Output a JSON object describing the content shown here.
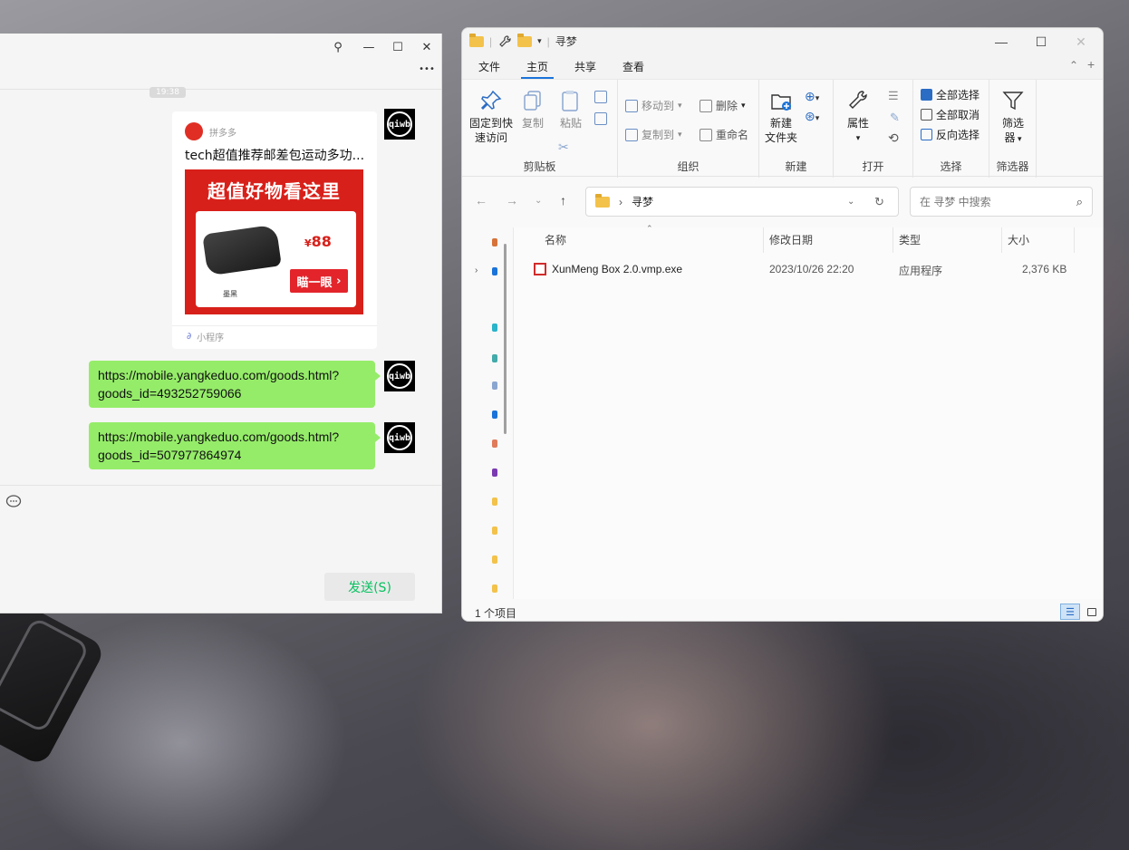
{
  "chat": {
    "time_chip": "19:38",
    "avatar_text": "qiwb",
    "mini_program": {
      "source": "拼多多",
      "title": "tech超值推荐邮差包运动多功...",
      "banner": "超值好物看这里",
      "price_symbol": "¥",
      "price": "88",
      "cta": "瞄一眼",
      "brand": "墨黑",
      "footer": "小程序"
    },
    "messages": [
      {
        "line1": "https://mobile.yangkeduo.com/goods.html?",
        "line2": "goods_id=493252759066"
      },
      {
        "line1": "https://mobile.yangkeduo.com/goods.html?",
        "line2": "goods_id=507977864974"
      }
    ],
    "send_label": "发送(S)",
    "controls": {
      "pin": "⚲",
      "min": "—",
      "max": "☐",
      "close": "✕",
      "more": "•••"
    }
  },
  "explorer": {
    "title": "寻梦",
    "tabs": [
      "文件",
      "主页",
      "共享",
      "查看"
    ],
    "active_tab": "主页",
    "ribbon": {
      "clipboard": {
        "label": "剪贴板",
        "pin_line1": "固定到快",
        "pin_line2": "速访问",
        "copy": "复制",
        "paste": "粘贴"
      },
      "organize": {
        "label": "组织",
        "move_to": "移动到",
        "copy_to": "复制到",
        "delete": "删除",
        "rename": "重命名"
      },
      "new": {
        "label": "新建",
        "new_folder_line1": "新建",
        "new_folder_line2": "文件夹"
      },
      "open": {
        "label": "打开",
        "properties": "属性"
      },
      "select": {
        "label": "选择",
        "select_all": "全部选择",
        "select_none": "全部取消",
        "invert": "反向选择"
      },
      "filter": {
        "label": "筛选器",
        "filter_line1": "筛选",
        "filter_line2": "器"
      }
    },
    "address": {
      "path": "寻梦",
      "search_placeholder": "在 寻梦 中搜索"
    },
    "columns": [
      "名称",
      "修改日期",
      "类型",
      "大小"
    ],
    "files": [
      {
        "name": "XunMeng Box 2.0.vmp.exe",
        "modified": "2023/10/26 22:20",
        "type": "应用程序",
        "size": "2,376 KB"
      }
    ],
    "status": "1 个项目"
  }
}
